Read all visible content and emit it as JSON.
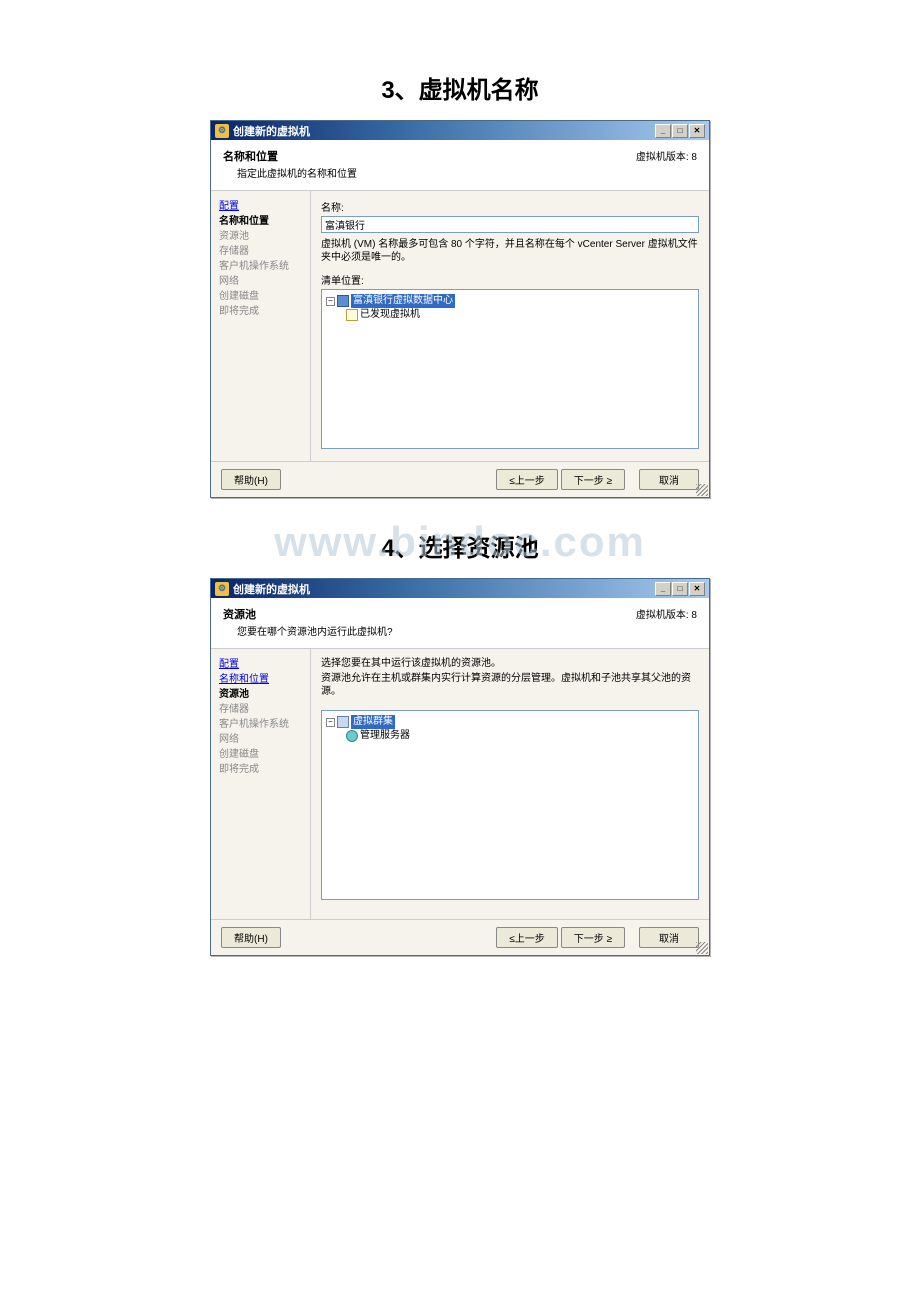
{
  "section1_title": "3、虚拟机名称",
  "section2_title": "4、选择资源池",
  "watermark": "www.bindoc.com",
  "dialog1": {
    "title": "创建新的虚拟机",
    "header_title": "名称和位置",
    "header_subtitle": "指定此虚拟机的名称和位置",
    "version": "虚拟机版本: 8",
    "sidebar": [
      {
        "label": "配置",
        "state": "link"
      },
      {
        "label": "名称和位置",
        "state": "active"
      },
      {
        "label": "资源池",
        "state": "disabled"
      },
      {
        "label": "存储器",
        "state": "disabled"
      },
      {
        "label": "客户机操作系统",
        "state": "disabled"
      },
      {
        "label": "网络",
        "state": "disabled"
      },
      {
        "label": "创建磁盘",
        "state": "disabled"
      },
      {
        "label": "即将完成",
        "state": "disabled"
      }
    ],
    "name_label": "名称:",
    "name_value": "富滇银行",
    "name_hint": "虚拟机 (VM) 名称最多可包含 80 个字符，并且名称在每个 vCenter Server 虚拟机文件夹中必须是唯一的。",
    "inventory_label": "清单位置:",
    "tree_root": "富滇银行虚拟数据中心",
    "tree_child": "已发现虚拟机",
    "btn_help": "帮助(H)",
    "btn_back": "≤上一步",
    "btn_next": "下一步 ≥",
    "btn_cancel": "取消"
  },
  "dialog2": {
    "title": "创建新的虚拟机",
    "header_title": "资源池",
    "header_subtitle": "您要在哪个资源池内运行此虚拟机?",
    "version": "虚拟机版本: 8",
    "sidebar": [
      {
        "label": "配置",
        "state": "link"
      },
      {
        "label": "名称和位置",
        "state": "link"
      },
      {
        "label": "资源池",
        "state": "active"
      },
      {
        "label": "存储器",
        "state": "disabled"
      },
      {
        "label": "客户机操作系统",
        "state": "disabled"
      },
      {
        "label": "网络",
        "state": "disabled"
      },
      {
        "label": "创建磁盘",
        "state": "disabled"
      },
      {
        "label": "即将完成",
        "state": "disabled"
      }
    ],
    "desc_line1": "选择您要在其中运行该虚拟机的资源池。",
    "desc_line2": "资源池允许在主机或群集内实行计算资源的分层管理。虚拟机和子池共享其父池的资源。",
    "tree_root": "虚拟群集",
    "tree_child": "管理服务器",
    "btn_help": "帮助(H)",
    "btn_back": "≤上一步",
    "btn_next": "下一步 ≥",
    "btn_cancel": "取消"
  }
}
